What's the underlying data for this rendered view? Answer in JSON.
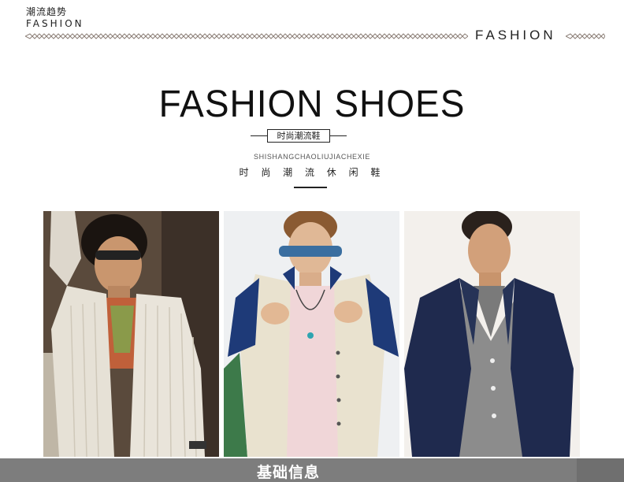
{
  "header": {
    "logo_cn": "潮流趋势",
    "logo_en": "FASHION",
    "header_word": "FASHION"
  },
  "hero": {
    "title": "FASHION SHOES",
    "subtitle_cn": "时尚潮流鞋",
    "pinyin": "SHISHANGCHAOLIUJIACHEXIE",
    "caption_cn": "时 尚 潮 流 休 闲 鞋"
  },
  "photos": [
    {
      "name": "model-photo-white-cardigan",
      "accent": "#e8e4dc"
    },
    {
      "name": "model-photo-varsity-jacket",
      "accent": "#1e3a78"
    },
    {
      "name": "model-photo-navy-blazer",
      "accent": "#1f2a4e"
    }
  ],
  "footer": {
    "label": "基础信息"
  },
  "colors": {
    "text": "#1a1a1a",
    "divider": "#8c7f77",
    "footer_bg": "#7d7d7d"
  }
}
